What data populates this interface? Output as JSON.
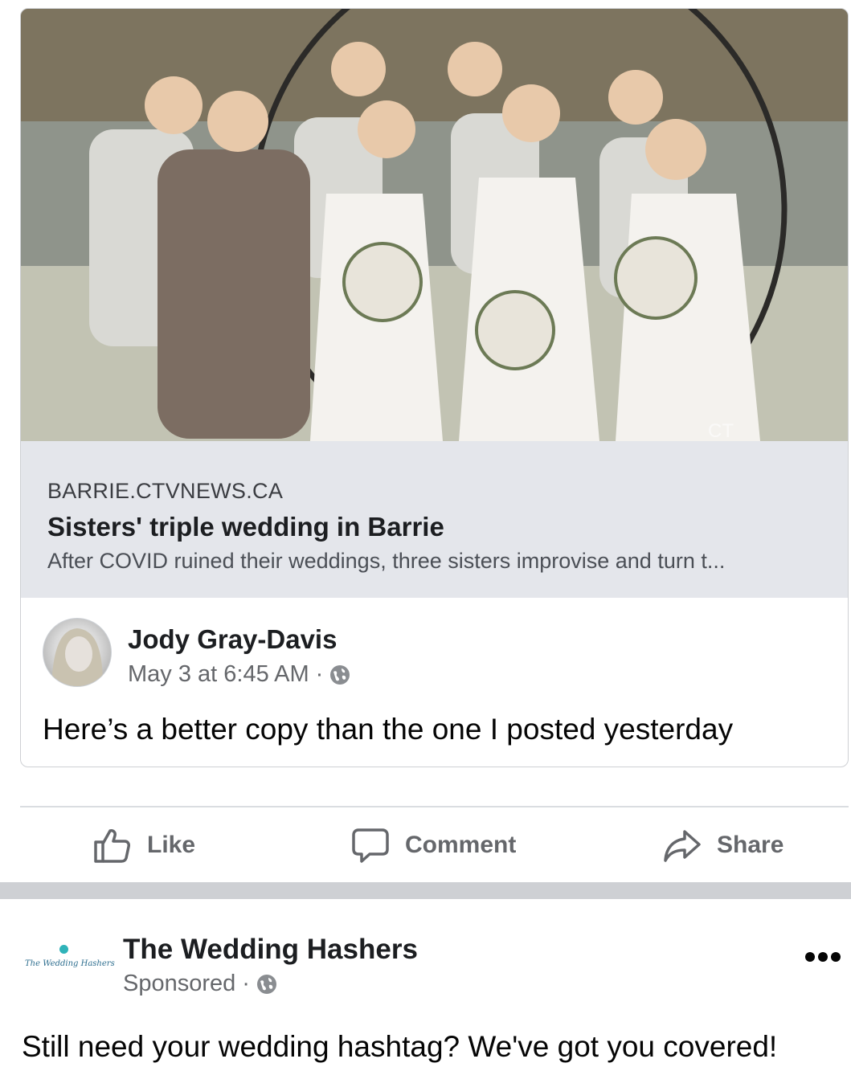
{
  "shared_post": {
    "image_alt": "Wedding party photo: three brides in white dresses with bouquets, parents and three groomsmen in front of a circular arch by a pond",
    "image_watermark": "CT",
    "link": {
      "domain": "BARRIE.CTVNEWS.CA",
      "title": "Sisters' triple wedding in Barrie",
      "description": "After COVID ruined their weddings, three sisters improvise and turn t..."
    },
    "author": {
      "name": "Jody Gray-Davis",
      "timestamp": "May 3 at 6:45 AM",
      "separator": "·",
      "privacy_icon": "globe-icon"
    },
    "text": "Here’s a better copy than the one I posted yesterday"
  },
  "actions": {
    "like": "Like",
    "comment": "Comment",
    "share": "Share"
  },
  "sponsored_post": {
    "page_logo_text": "The Wedding Hashers",
    "page_name": "The Wedding Hashers",
    "label": "Sponsored",
    "separator": "·",
    "privacy_icon": "globe-icon",
    "more_icon": "more-options-icon",
    "text": "Still need your wedding hashtag? We've got you covered!"
  },
  "colors": {
    "secondary_text": "#65676b",
    "link_preview_bg": "#e4e6eb",
    "divider": "#ced0d4",
    "logo_accent": "#2fb3b9"
  }
}
